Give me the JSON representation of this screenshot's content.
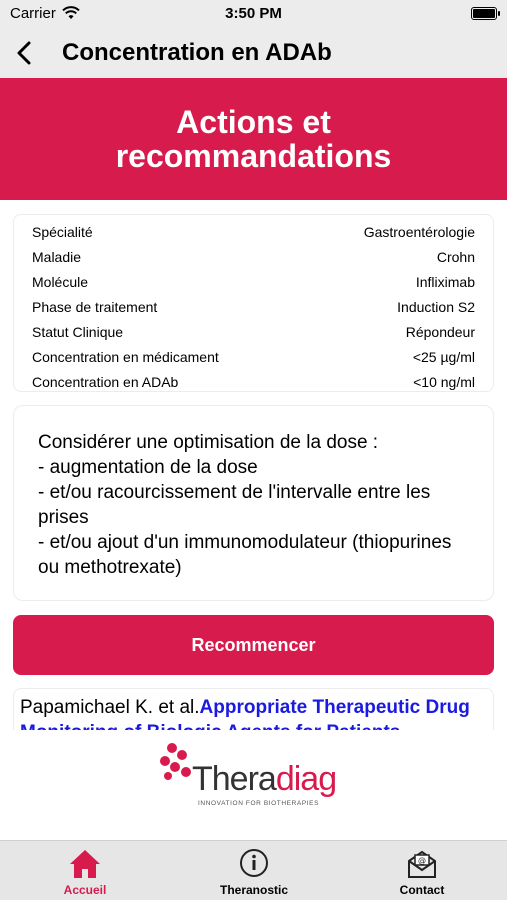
{
  "status_bar": {
    "carrier": "Carrier",
    "time": "3:50 PM"
  },
  "nav": {
    "title": "Concentration en ADAb"
  },
  "banner": {
    "title": "Actions et recommandations"
  },
  "info": {
    "rows": [
      {
        "label": "Spécialité",
        "value": "Gastroentérologie"
      },
      {
        "label": "Maladie",
        "value": "Crohn"
      },
      {
        "label": "Molécule",
        "value": "Infliximab"
      },
      {
        "label": "Phase de traitement",
        "value": "Induction S2"
      },
      {
        "label": "Statut Clinique",
        "value": "Répondeur"
      },
      {
        "label": "Concentration en médicament",
        "value": "<25 µg/ml"
      },
      {
        "label": "Concentration en ADAb",
        "value": "<10 ng/ml"
      }
    ]
  },
  "advice": {
    "text": "Considérer une optimisation de la dose :\n- augmentation de la dose\n- et/ou racourcissement de l'intervalle entre les prises\n- et/ou ajout d'un immunomodulateur (thiopurines ou methotrexate)"
  },
  "actions": {
    "restart_label": "Recommencer"
  },
  "reference": {
    "authors": "Papamichael K. et al.",
    "link_text": "Appropriate Therapeutic Drug Monitoring of Biologic Agents for Patients"
  },
  "logo": {
    "name_part1": "Thera",
    "name_part2": "diag",
    "tagline": "INNOVATION FOR BIOTHERAPIES"
  },
  "tabs": [
    {
      "label": "Accueil",
      "icon": "home-icon",
      "active": true
    },
    {
      "label": "Theranostic",
      "icon": "info-icon",
      "active": false
    },
    {
      "label": "Contact",
      "icon": "mail-icon",
      "active": false
    }
  ],
  "colors": {
    "accent": "#d81b4d",
    "link": "#1a1ae0",
    "background": "#f2f2f2"
  }
}
